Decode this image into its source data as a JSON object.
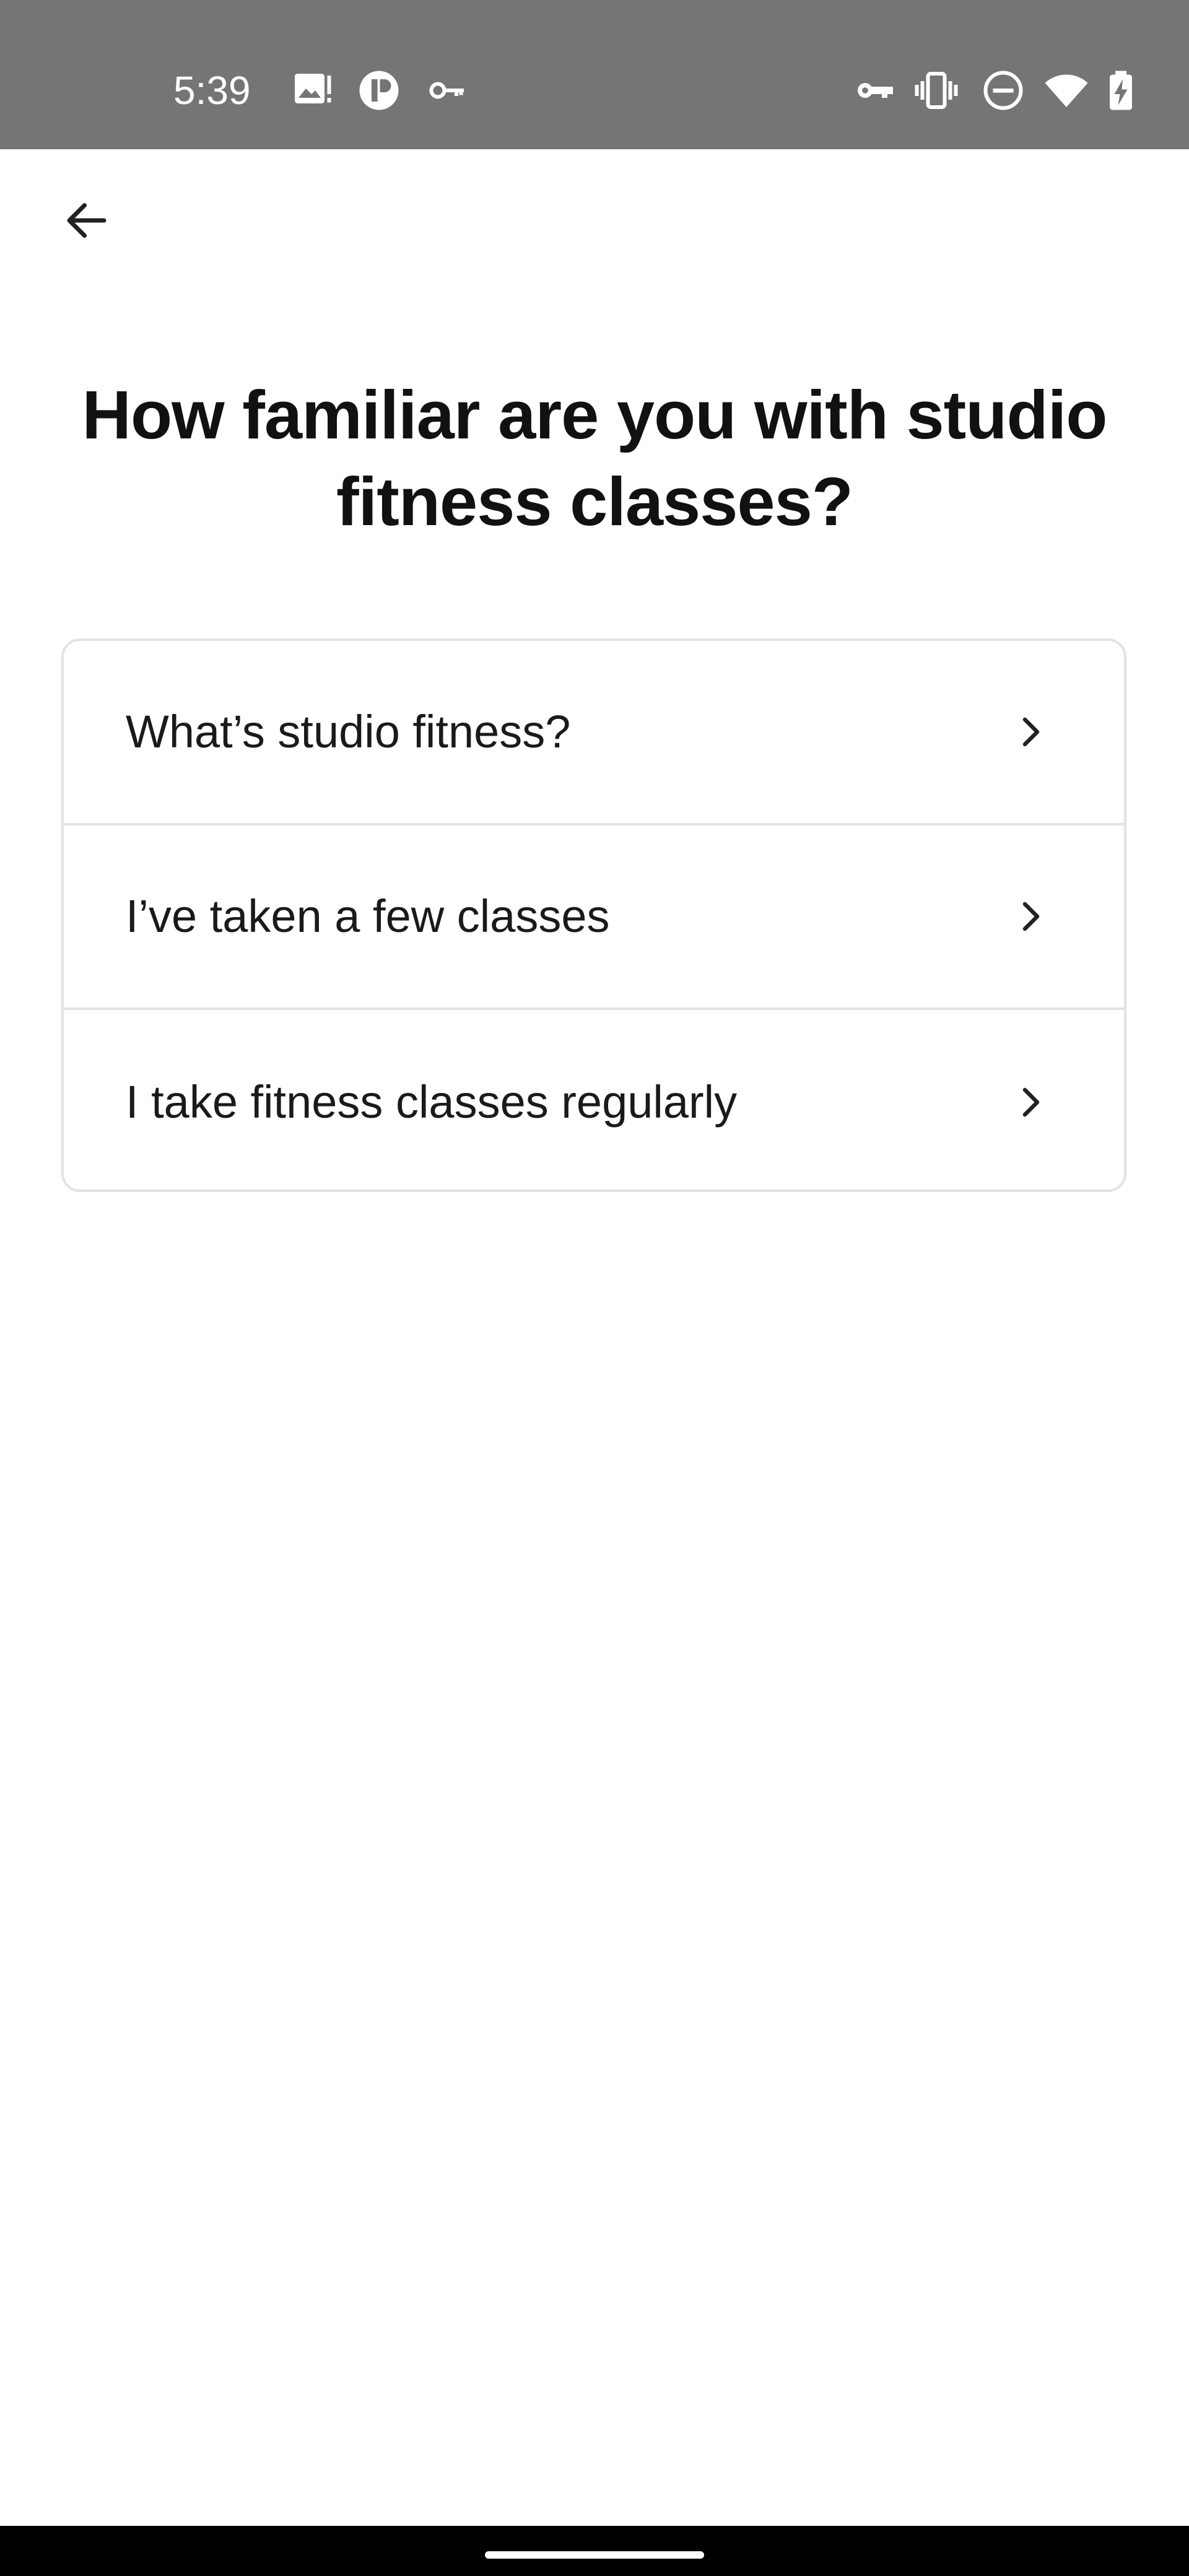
{
  "status_bar": {
    "time": "5:39",
    "left_icons": [
      "image-alert-icon",
      "app-logo-icon",
      "key-icon"
    ],
    "right_icons": [
      "vpn-key-icon",
      "vibrate-icon",
      "do-not-disturb-icon",
      "wifi-icon",
      "battery-charging-icon"
    ]
  },
  "header": {
    "back_icon": "arrow-left-icon"
  },
  "question": {
    "title": "How familiar are you with studio fitness classes?"
  },
  "options": [
    {
      "label": "What’s studio fitness?"
    },
    {
      "label": "I’ve taken a few classes"
    },
    {
      "label": "I take fitness classes regularly"
    }
  ],
  "colors": {
    "status_bar_bg": "#757575",
    "card_border": "#e3e3e3",
    "text_primary": "#111111"
  }
}
